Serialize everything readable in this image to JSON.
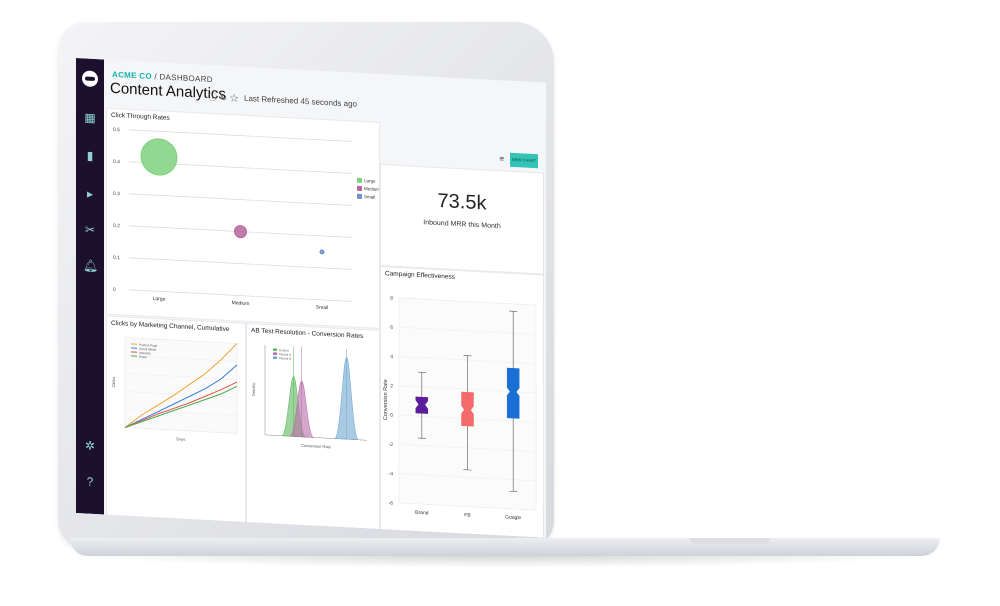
{
  "app": {
    "company": "ACME CO",
    "separator": " / ",
    "section": "DASHBOARD",
    "title": "Content Analytics",
    "refreshed": "Last Refreshed 45 seconds ago",
    "new_chart_label": "NEW CHART"
  },
  "sidebar": {
    "icons": [
      "dashboard-icon",
      "bookmark-icon",
      "play-icon",
      "scissors-icon",
      "bell-icon",
      "gear-icon",
      "help-icon"
    ]
  },
  "kpi": {
    "value": "73.5k",
    "label": "Inbound MRR this Month"
  },
  "chart_data": [
    {
      "type": "scatter",
      "title": "Click Through Rates",
      "categories": [
        "Large",
        "Medium",
        "Small"
      ],
      "values": [
        0.42,
        0.2,
        0.15
      ],
      "sizes": [
        "large",
        "medium",
        "small"
      ],
      "legend": [
        "Large",
        "Medium",
        "Small"
      ],
      "ylim": [
        0,
        0.5
      ],
      "yticks": [
        "0.5",
        "0.4",
        "0.3",
        "0.2",
        "0.1",
        "0"
      ],
      "colors": [
        "#7fd17f",
        "#b8669c",
        "#6f93c8"
      ]
    },
    {
      "type": "line",
      "title": "Clicks by Marketing Channel, Cumulative",
      "series": [
        {
          "name": "Product Page",
          "color": "#f2a33a",
          "values": [
            0,
            60,
            110,
            160,
            215,
            270,
            340,
            420
          ]
        },
        {
          "name": "Social Media",
          "color": "#3a7fd9",
          "values": [
            0,
            40,
            80,
            120,
            160,
            200,
            250,
            320
          ]
        },
        {
          "name": "Adwords",
          "color": "#e0564c",
          "values": [
            0,
            35,
            70,
            100,
            130,
            165,
            200,
            240
          ]
        },
        {
          "name": "Email",
          "color": "#4caf50",
          "values": [
            0,
            30,
            60,
            90,
            120,
            150,
            180,
            220
          ]
        }
      ],
      "xlabel": "Days",
      "ylabel": "Clicks"
    },
    {
      "type": "area",
      "title": "AB Test Resolution - Conversion Rates",
      "series": [
        {
          "name": "Control",
          "color": "#5cb85c",
          "peak": 0.12
        },
        {
          "name": "Variant A",
          "color": "#b76aa8",
          "peak": 0.14
        },
        {
          "name": "Variant B",
          "color": "#6ea6cf",
          "peak": 0.25
        }
      ],
      "xlabel": "Conversion Rate",
      "ylabel": "Density"
    },
    {
      "type": "box",
      "title": "Campaign Effectiveness",
      "ylabel": "Conversion Rate",
      "categories": [
        "Brand",
        "FB",
        "Google"
      ],
      "ylim": [
        -6,
        8
      ],
      "yticks": [
        "8",
        "6",
        "4",
        "2",
        "0",
        "-2",
        "-4",
        "-6"
      ],
      "boxes": [
        {
          "name": "Brand",
          "color": "#5a1e9a",
          "min": -1.5,
          "q1": 0.2,
          "median": 0.8,
          "q3": 1.3,
          "max": 3.0
        },
        {
          "name": "FB",
          "color": "#f46a6a",
          "min": -3.5,
          "q1": -0.5,
          "median": 0.6,
          "q3": 1.8,
          "max": 4.3
        },
        {
          "name": "Google",
          "color": "#1a6fd4",
          "min": -4.8,
          "q1": 0.2,
          "median": 2.0,
          "q3": 3.6,
          "max": 7.5
        }
      ]
    }
  ]
}
